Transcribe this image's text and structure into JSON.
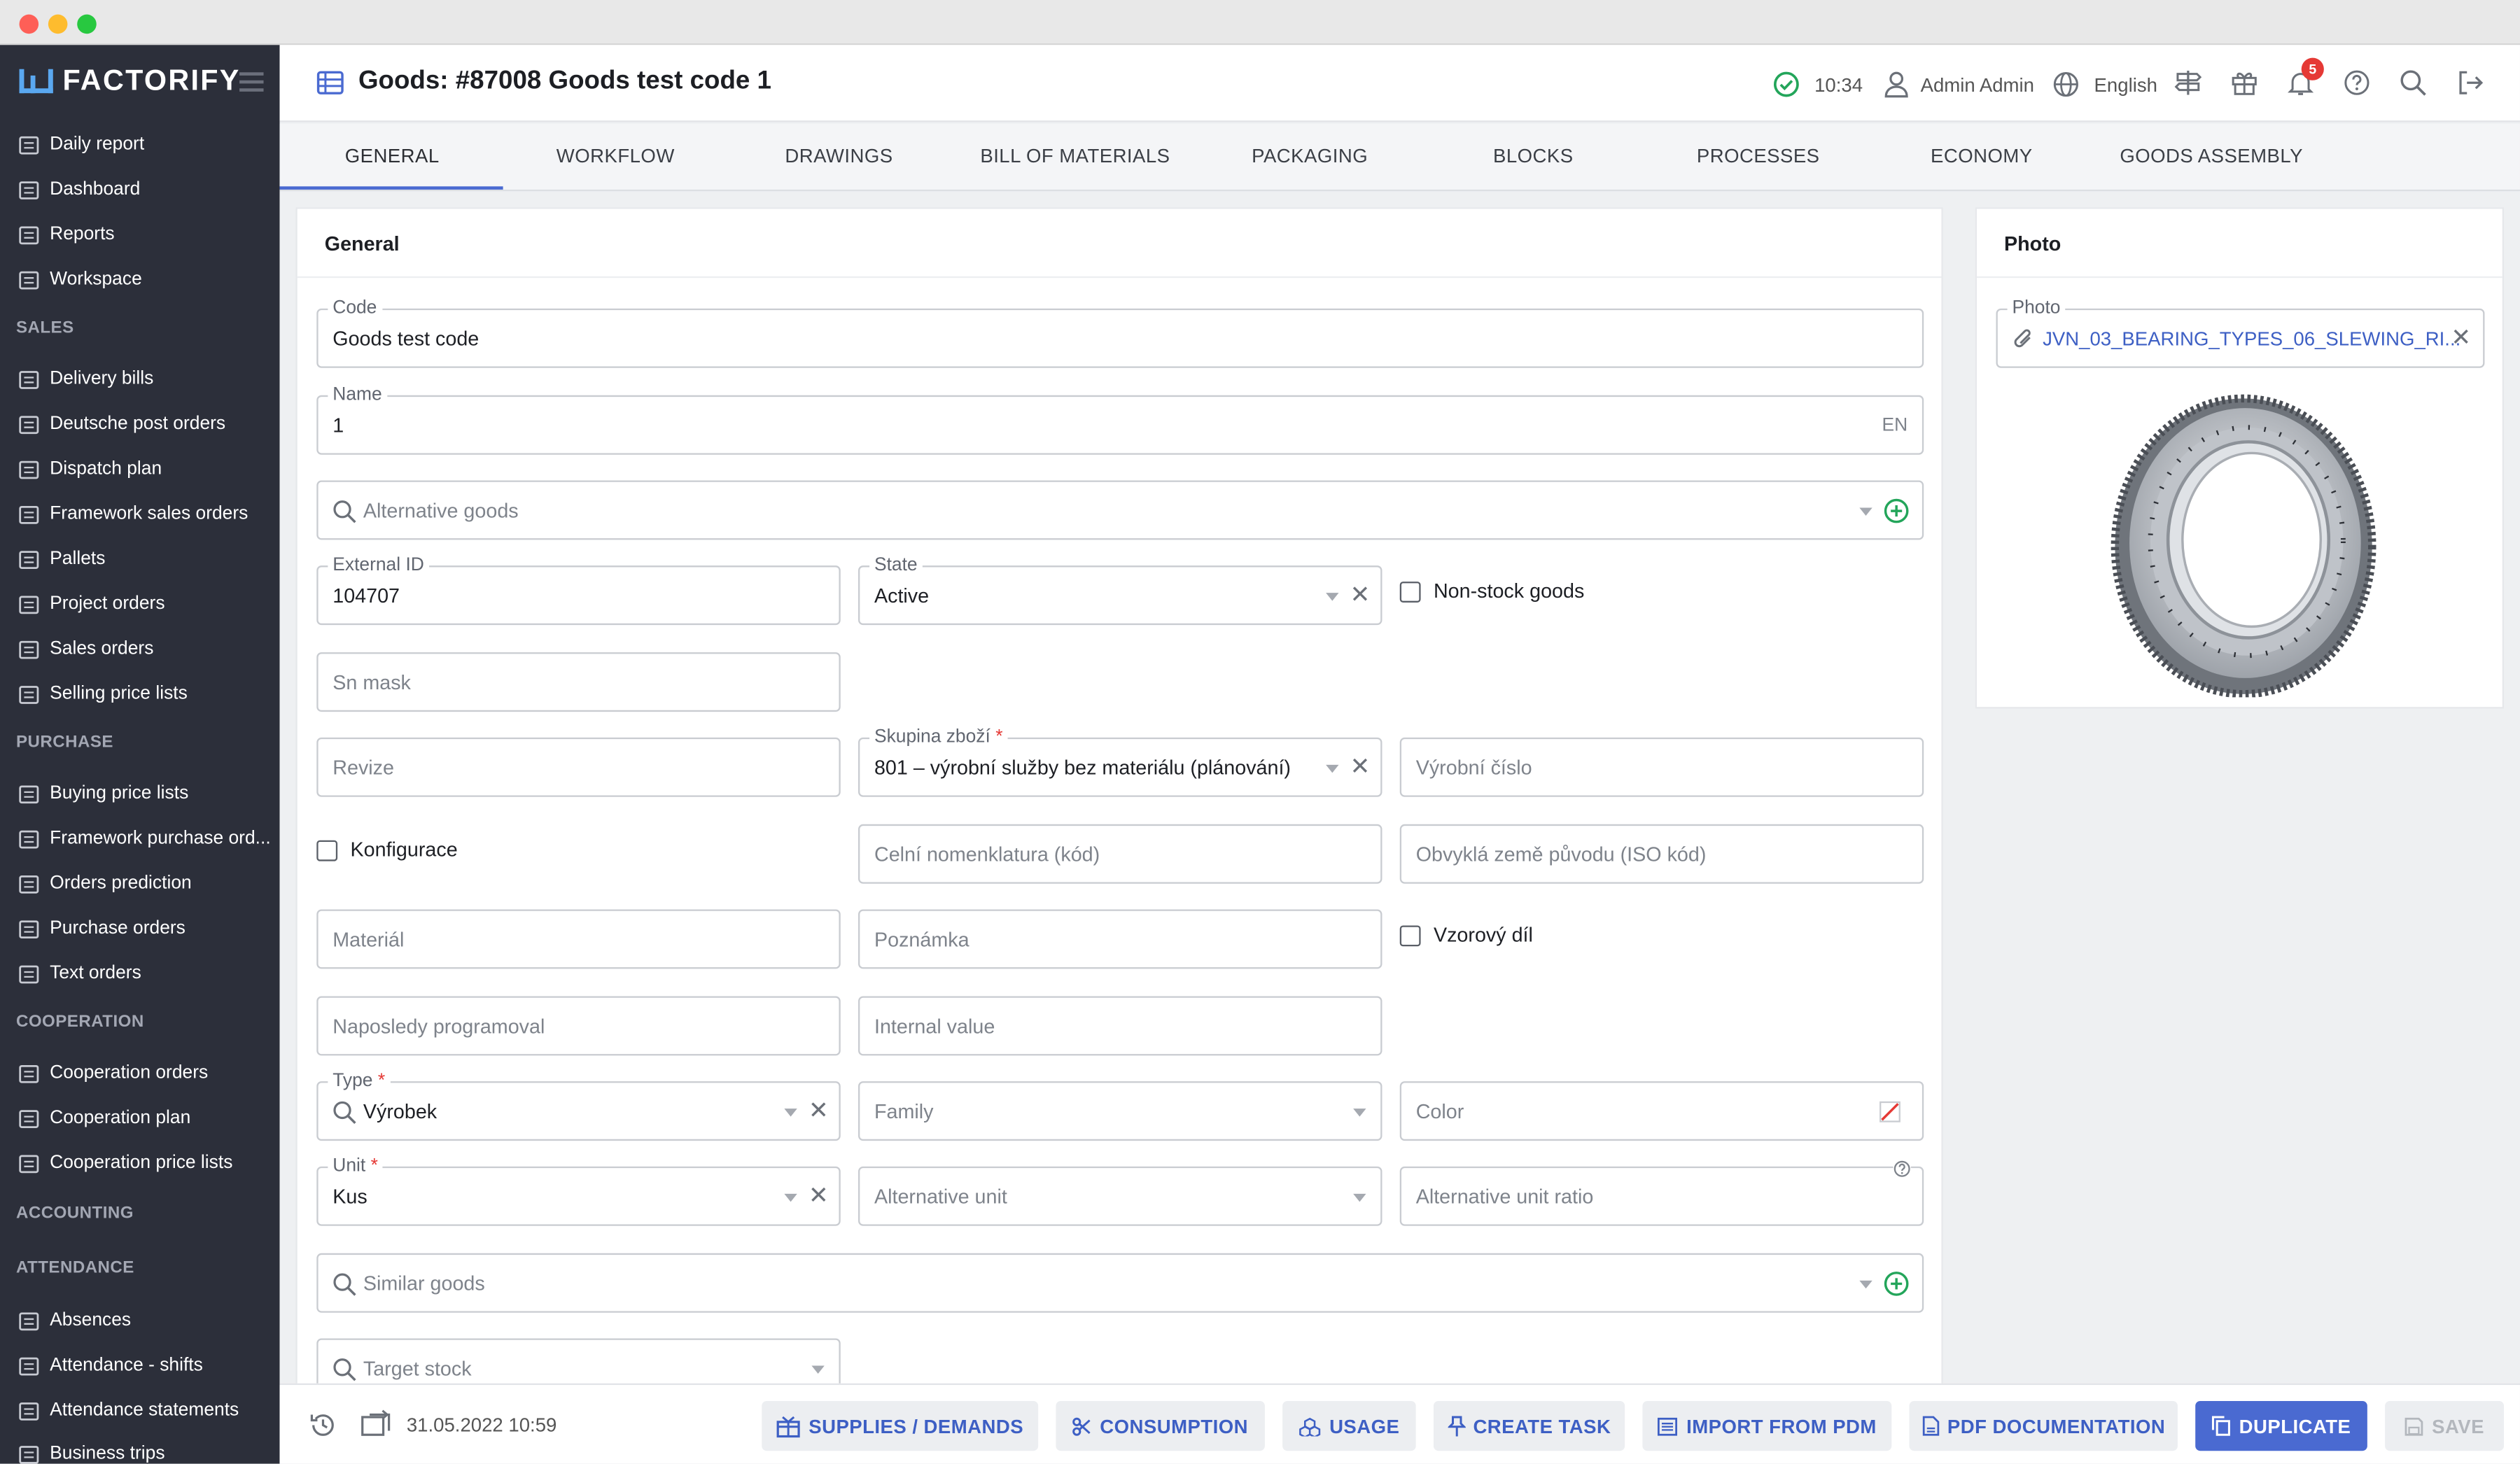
{
  "window": {
    "colors": {
      "close": "#fe5f57",
      "minimize": "#febc2e",
      "maximize": "#28c840"
    }
  },
  "brand": {
    "name": "FACTORIFY",
    "accent": "#4a6ad1"
  },
  "sidebar": {
    "items_top": [
      {
        "label": "Daily report",
        "icon": "chart-area-icon"
      },
      {
        "label": "Dashboard",
        "icon": "gauge-icon"
      },
      {
        "label": "Reports",
        "icon": "bar-chart-icon"
      },
      {
        "label": "Workspace",
        "icon": "workspace-icon"
      }
    ],
    "sections": [
      {
        "title": "SALES",
        "items": [
          {
            "label": "Delivery bills",
            "icon": "document-icon"
          },
          {
            "label": "Deutsche post orders",
            "icon": "megaphone-icon"
          },
          {
            "label": "Dispatch plan",
            "icon": "calendar-icon"
          },
          {
            "label": "Framework sales orders",
            "icon": "cart-icon"
          },
          {
            "label": "Pallets",
            "icon": "pallet-icon"
          },
          {
            "label": "Project orders",
            "icon": "project-icon"
          },
          {
            "label": "Sales orders",
            "icon": "document-icon"
          },
          {
            "label": "Selling price lists",
            "icon": "price-list-icon"
          }
        ]
      },
      {
        "title": "PURCHASE",
        "items": [
          {
            "label": "Buying price lists",
            "icon": "price-list-icon"
          },
          {
            "label": "Framework purchase ord...",
            "icon": "cart-icon"
          },
          {
            "label": "Orders prediction",
            "icon": "trend-icon"
          },
          {
            "label": "Purchase orders",
            "icon": "document-icon"
          },
          {
            "label": "Text orders",
            "icon": "document-icon"
          }
        ]
      },
      {
        "title": "COOPERATION",
        "items": [
          {
            "label": "Cooperation orders",
            "icon": "document-icon"
          },
          {
            "label": "Cooperation plan",
            "icon": "list-icon"
          },
          {
            "label": "Cooperation price lists",
            "icon": "share-icon"
          }
        ]
      },
      {
        "title": "ACCOUNTING",
        "items": []
      },
      {
        "title": "ATTENDANCE",
        "items": [
          {
            "label": "Absences",
            "icon": "user-minus-icon"
          },
          {
            "label": "Attendance - shifts",
            "icon": "ticket-icon"
          },
          {
            "label": "Attendance statements",
            "icon": "bank-icon"
          },
          {
            "label": "Business trips",
            "icon": "globe-icon"
          }
        ]
      }
    ]
  },
  "header": {
    "title": "Goods: #87008 Goods test code 1",
    "time": "10:34",
    "user": "Admin Admin",
    "language": "English",
    "notifications": "5"
  },
  "tabs": [
    "GENERAL",
    "WORKFLOW",
    "DRAWINGS",
    "BILL OF MATERIALS",
    "PACKAGING",
    "BLOCKS",
    "PROCESSES",
    "ECONOMY",
    "GOODS ASSEMBLY"
  ],
  "general": {
    "heading": "General",
    "code": {
      "label": "Code",
      "value": "Goods test code"
    },
    "name": {
      "label": "Name",
      "value": "1",
      "lang": "EN"
    },
    "alternative_goods": {
      "placeholder": "Alternative goods"
    },
    "external_id": {
      "label": "External ID",
      "value": "104707"
    },
    "state": {
      "label": "State",
      "value": "Active"
    },
    "non_stock": {
      "label": "Non-stock goods"
    },
    "sn_mask": {
      "placeholder": "Sn mask"
    },
    "revize": {
      "placeholder": "Revize"
    },
    "skupina": {
      "label": "Skupina zboží",
      "value": "801 – výrobní služby bez materiálu (plánování)"
    },
    "vyrobni_cislo": {
      "placeholder": "Výrobní číslo"
    },
    "konfigurace": {
      "label": "Konfigurace"
    },
    "celni": {
      "placeholder": "Celní nomenklatura (kód)"
    },
    "zeme": {
      "placeholder": "Obvyklá země původu (ISO kód)"
    },
    "material": {
      "placeholder": "Materiál"
    },
    "poznamka": {
      "placeholder": "Poznámka"
    },
    "vzorovy": {
      "label": "Vzorový díl"
    },
    "naposledy": {
      "placeholder": "Naposledy programoval"
    },
    "internal_value": {
      "placeholder": "Internal value"
    },
    "type": {
      "label": "Type",
      "value": "Výrobek"
    },
    "family": {
      "placeholder": "Family"
    },
    "color": {
      "placeholder": "Color"
    },
    "unit": {
      "label": "Unit",
      "value": "Kus"
    },
    "alt_unit": {
      "placeholder": "Alternative unit"
    },
    "alt_unit_ratio": {
      "placeholder": "Alternative unit ratio"
    },
    "similar_goods": {
      "placeholder": "Similar goods"
    },
    "target_stock": {
      "placeholder": "Target stock"
    }
  },
  "photo": {
    "heading": "Photo",
    "label": "Photo",
    "filename": "JVN_03_BEARING_TYPES_06_SLEWING_RI..."
  },
  "footer": {
    "timestamp": "31.05.2022 10:59",
    "buttons": {
      "supplies": "SUPPLIES / DEMANDS",
      "consumption": "CONSUMPTION",
      "usage": "USAGE",
      "create_task": "CREATE TASK",
      "import_pdm": "IMPORT FROM PDM",
      "pdf_doc": "PDF DOCUMENTATION",
      "duplicate": "DUPLICATE",
      "save": "SAVE"
    }
  }
}
